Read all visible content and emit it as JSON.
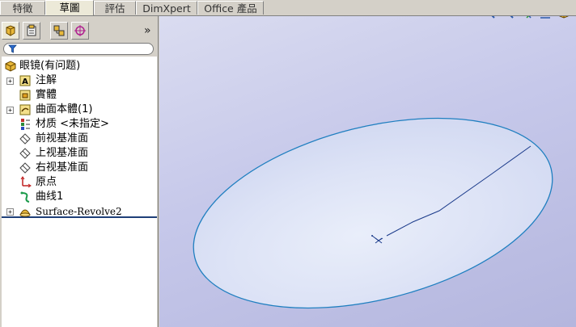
{
  "tabs": [
    {
      "label": "特徵",
      "active": false
    },
    {
      "label": "草圖",
      "active": true
    },
    {
      "label": "評估",
      "active": false
    },
    {
      "label": "DimXpert",
      "active": false
    },
    {
      "label": "Office 產品",
      "active": false
    }
  ],
  "panel": {
    "expand_glyph": "»",
    "filter_placeholder": ""
  },
  "tree": {
    "root": "眼镜(有问题)",
    "items": [
      {
        "label": "注解",
        "icon": "annotations-icon",
        "expandable": true
      },
      {
        "label": "實體",
        "icon": "solid-bodies-icon",
        "expandable": false
      },
      {
        "label": "曲面本體(1)",
        "icon": "surface-bodies-icon",
        "expandable": true
      },
      {
        "label": "材质 <未指定>",
        "icon": "material-icon",
        "expandable": false
      },
      {
        "label": "前视基准面",
        "icon": "plane-icon",
        "expandable": false
      },
      {
        "label": "上视基准面",
        "icon": "plane-icon",
        "expandable": false
      },
      {
        "label": "右视基准面",
        "icon": "plane-icon",
        "expandable": false
      },
      {
        "label": "原点",
        "icon": "origin-icon",
        "expandable": false
      },
      {
        "label": "曲线1",
        "icon": "curve-icon",
        "expandable": false
      },
      {
        "label": "Surface-Revolve2",
        "icon": "revolve-surface-icon",
        "expandable": true
      }
    ]
  },
  "colors": {
    "edge_blue": "#1f7fc0",
    "surface_fill": "#dfe5f6",
    "tree_separator": "#1e3f78"
  }
}
